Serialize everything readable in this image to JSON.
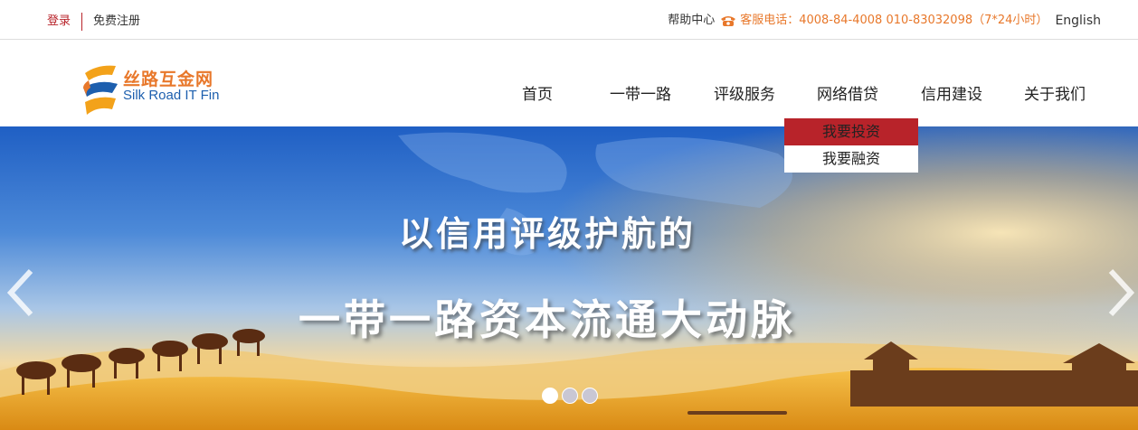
{
  "topbar": {
    "login": "登录",
    "register": "免费注册",
    "help": "帮助中心",
    "phone_label": "客服电话：4008-84-4008 010-83032098（7*24小时）",
    "english": "English",
    "accent_color": "#b8232a",
    "phone_color": "#e8782b"
  },
  "logo": {
    "cn": "丝路互金网",
    "en": "Silk Road IT Fin"
  },
  "nav": {
    "items": [
      {
        "label": "首页"
      },
      {
        "label": "一带一路"
      },
      {
        "label": "评级服务"
      },
      {
        "label": "网络借贷"
      },
      {
        "label": "信用建设"
      },
      {
        "label": "关于我们"
      }
    ]
  },
  "dropdown": {
    "items": [
      {
        "label": "我要投资",
        "active": true
      },
      {
        "label": "我要融资",
        "active": false
      }
    ]
  },
  "banner": {
    "headline1": "以信用评级护航的",
    "headline2": "一带一路资本流通大动脉",
    "slides": 3,
    "active_slide": 1
  }
}
